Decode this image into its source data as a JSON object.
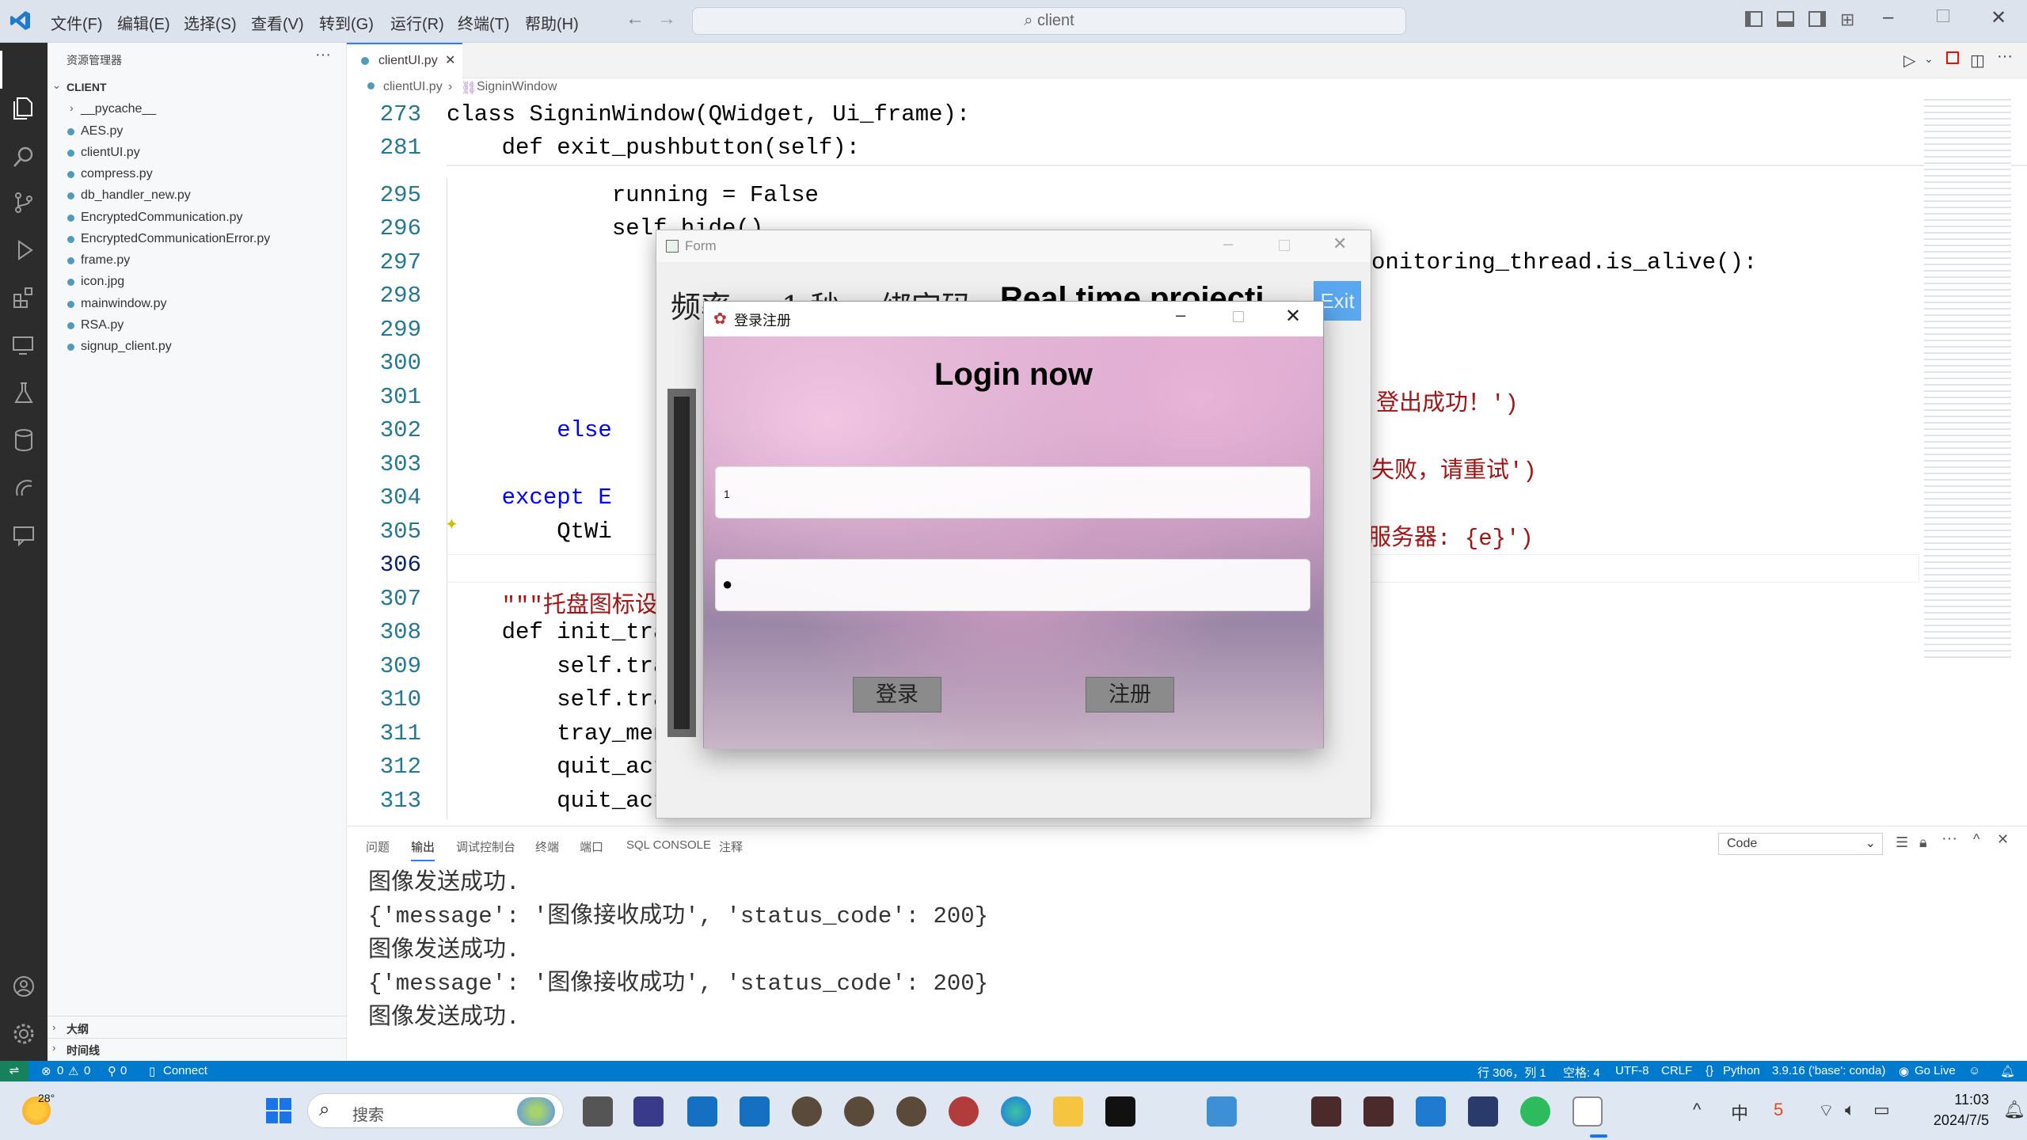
{
  "menu": [
    "文件(F)",
    "编辑(E)",
    "选择(S)",
    "查看(V)",
    "转到(G)",
    "运行(R)",
    "终端(T)",
    "帮助(H)"
  ],
  "search": {
    "text": "client"
  },
  "sidebar": {
    "title": "资源管理器",
    "root": "CLIENT",
    "items": [
      "__pycache__",
      "AES.py",
      "clientUI.py",
      "compress.py",
      "db_handler_new.py",
      "EncryptedCommunication.py",
      "EncryptedCommunicationError.py",
      "frame.py",
      "icon.jpg",
      "mainwindow.py",
      "RSA.py",
      "signup_client.py"
    ],
    "outline": "大纲",
    "timeline": "时间线"
  },
  "editor": {
    "tab": "clientUI.py",
    "breadcrumb": [
      "clientUI.py",
      "SigninWindow"
    ],
    "line_numbers": [
      "273",
      "281",
      "295",
      "296",
      "297",
      "298",
      "299",
      "300",
      "301",
      "302",
      "303",
      "304",
      "305",
      "306",
      "307",
      "308",
      "309",
      "310",
      "311",
      "312",
      "313"
    ],
    "lines": {
      "l273": "class SigninWindow(QWidget, Ui_frame):",
      "l281": "    def exit_pushbutton(self):",
      "l295": "            running = False",
      "l296": "            self.hide()",
      "l297": "onitoring_thread.is_alive():",
      "l301": "登出成功！')",
      "l302": "        else",
      "l303": "失败，请重试')",
      "l304": "    except E",
      "l305a": "        QtWi",
      "l305b": "服务器: {e}')",
      "l307": "    \"\"\"托盘图标设",
      "l308": "    def init_tra",
      "l309": "        self.tra",
      "l310": "        self.tra",
      "l311": "        tray_men",
      "l312": "        quit_act",
      "l313": "        quit_act"
    }
  },
  "panel": {
    "tabs": [
      "问题",
      "输出",
      "调试控制台",
      "终端",
      "端口",
      "SQL CONSOLE",
      "注释"
    ],
    "dropdown": "Code",
    "output": [
      "图像发送成功.",
      "{'message': '图像接收成功', 'status_code': 200}",
      "图像发送成功.",
      "{'message': '图像接收成功', 'status_code': 200}",
      "图像发送成功."
    ]
  },
  "status": {
    "errors": "0",
    "warnings": "0",
    "ports": "0",
    "connect": "Connect",
    "position": "行 306，列 1",
    "spaces": "空格: 4",
    "encoding": "UTF-8",
    "eol": "CRLF",
    "lang": "Python",
    "interpreter": "3.9.16 ('base': conda)",
    "golive": "Go Live"
  },
  "form_window": {
    "title": "Form",
    "label_freq": "频率",
    "label_sec": "1 秒",
    "label_bind": "绑定码",
    "label_realtime": "Real time projecti",
    "exit": "Exit"
  },
  "login_window": {
    "title": "登录注册",
    "heading": "Login now",
    "username_value": "1",
    "password_value": "●",
    "login_button": "登录",
    "register_button": "注册"
  },
  "taskbar": {
    "weather": "28°",
    "search": "搜索",
    "time": "11:03",
    "date": "2024/7/5"
  },
  "colors": {
    "accent": "#007acc",
    "keyword": "#0000ff",
    "string": "#a31515"
  }
}
